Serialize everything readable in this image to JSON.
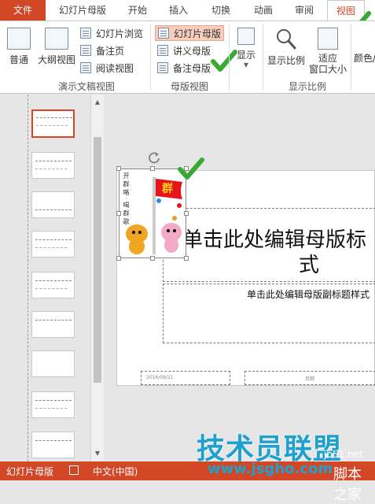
{
  "tabs": {
    "file": "文件",
    "items": [
      "幻灯片母版",
      "开始",
      "插入",
      "切换",
      "动画",
      "审阅",
      "视图"
    ]
  },
  "ribbon": {
    "presentation_views": {
      "normal": "普通",
      "outline": "大纲视图",
      "slide_sorter": "幻灯片浏览",
      "notes_page": "备注页",
      "reading_view": "阅读视图",
      "group_label": "演示文稿视图"
    },
    "master_views": {
      "slide_master": "幻灯片母版",
      "handout_master": "讲义母版",
      "notes_master": "备注母版",
      "group_label": "母版视图"
    },
    "show": {
      "label": "显示"
    },
    "zoom": {
      "zoom": "显示比例",
      "fit_line1": "适应",
      "fit_line2": "窗口大小",
      "group_label": "显示比例"
    },
    "color": {
      "label": "颜色/"
    }
  },
  "slide": {
    "title_line1": "单击此处编辑母版标",
    "title_line2": "式",
    "subtitle": "单击此处编辑母版副标题样式",
    "date": "2016/09/21",
    "footer_right": "页脚",
    "flag_text": "群",
    "vertical_text": "开 群 咯 · 喝 群 歌"
  },
  "status": {
    "view": "幻灯片母版",
    "language": "中文(中国)"
  },
  "watermark": {
    "main": "技术员联盟",
    "url": "www.jsgho.com",
    "site": "jb51.net",
    "tail": "脚本之家"
  },
  "colors": {
    "accent": "#d24726",
    "check": "#3aa934",
    "watermark": "#1ea1cf"
  }
}
